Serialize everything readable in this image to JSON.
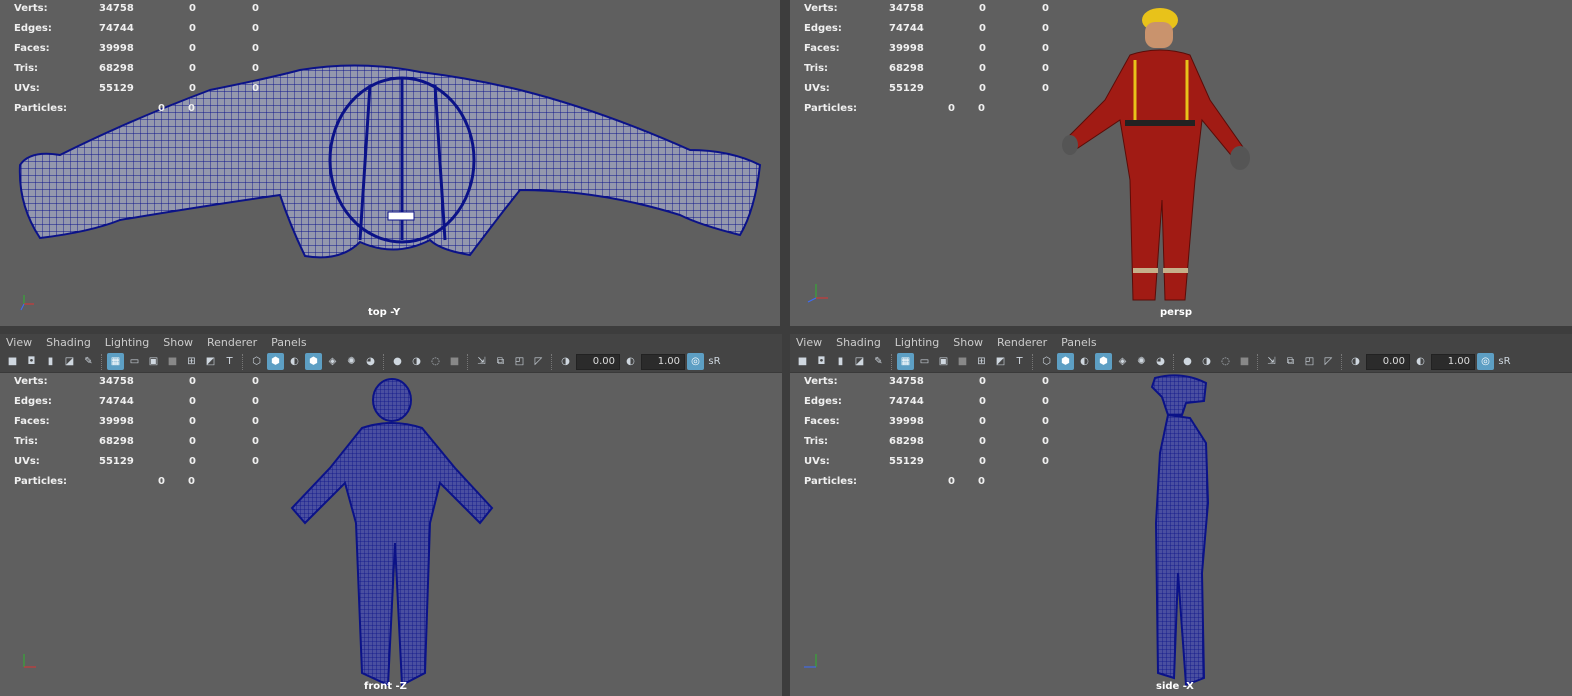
{
  "menu": [
    "View",
    "Shading",
    "Lighting",
    "Show",
    "Renderer",
    "Panels"
  ],
  "toolbar": {
    "exposure": "0.00",
    "gamma": "1.00",
    "colorspace": "sR"
  },
  "hud_labels": {
    "verts": "Verts:",
    "edges": "Edges:",
    "faces": "Faces:",
    "tris": "Tris:",
    "uvs": "UVs:",
    "particles": "Particles:"
  },
  "hud_values": {
    "verts": [
      "34758",
      "0",
      "0"
    ],
    "edges": [
      "74744",
      "0",
      "0"
    ],
    "faces": [
      "39998",
      "0",
      "0"
    ],
    "tris": [
      "68298",
      "0",
      "0"
    ],
    "uvs": [
      "55129",
      "0",
      "0"
    ],
    "particles": [
      "0",
      "0"
    ]
  },
  "viewports": {
    "top": {
      "label": "top -Y"
    },
    "persp": {
      "label": "persp"
    },
    "front": {
      "label": "front -Z"
    },
    "side": {
      "label": "side -X"
    }
  },
  "axis": {
    "x": "x",
    "y": "y",
    "z": "z"
  },
  "colors": {
    "wire": "#0b1288",
    "shade": "#8a90a8",
    "suit": "#a11b14",
    "helmet": "#e8c21a",
    "bg": "#606060"
  }
}
